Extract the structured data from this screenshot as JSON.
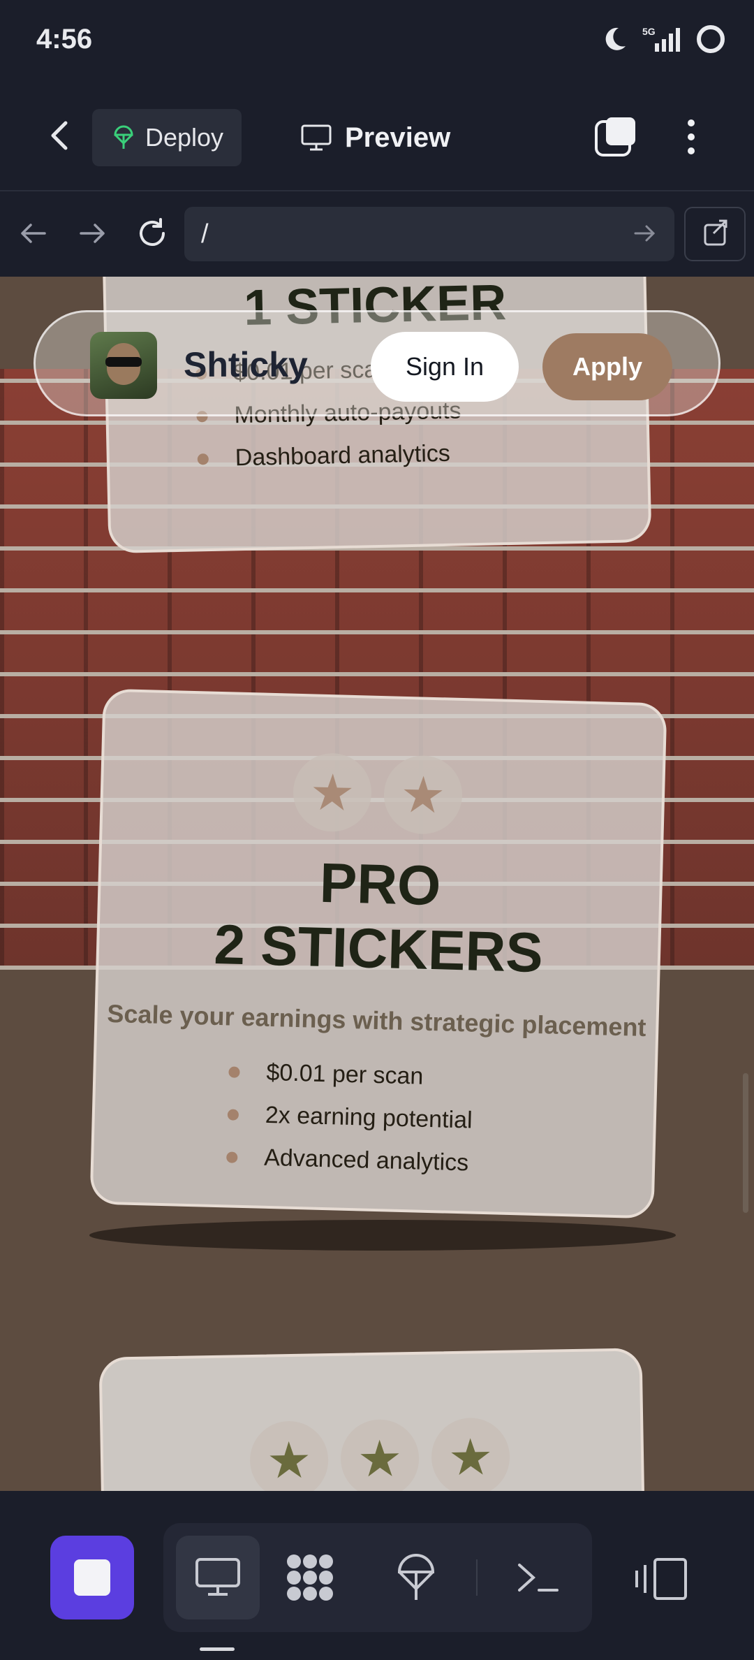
{
  "status_bar": {
    "time": "4:56",
    "network": "5G"
  },
  "toolbar": {
    "deploy_label": "Deploy",
    "preview_label": "Preview"
  },
  "url_bar": {
    "url": "/"
  },
  "site": {
    "brand": "Shticky",
    "sign_in_label": "Sign In",
    "apply_label": "Apply",
    "tiers": [
      {
        "title": "1 STICKER",
        "features": [
          "$0.01 per scan",
          "Monthly auto-payouts",
          "Dashboard analytics"
        ]
      },
      {
        "title_line1": "PRO",
        "title_line2": "2 STICKERS",
        "subtitle": "Scale your earnings with strategic placement",
        "features": [
          "$0.01 per scan",
          "2x earning potential",
          "Advanced analytics"
        ],
        "stars": 2
      },
      {
        "stars": 3
      }
    ]
  },
  "colors": {
    "accent": "#5b3ee0",
    "apply": "#9e7b62",
    "background": "#1b1e2a"
  },
  "icons": [
    "back-icon",
    "deploy-icon",
    "preview-monitor-icon",
    "tabs-icon",
    "kebab-menu-icon",
    "nav-back-icon",
    "nav-forward-icon",
    "reload-icon",
    "go-arrow-icon",
    "external-link-icon",
    "stop-icon",
    "monitor-icon",
    "workflow-icon",
    "deploy-icon",
    "terminal-icon",
    "devices-icon"
  ]
}
